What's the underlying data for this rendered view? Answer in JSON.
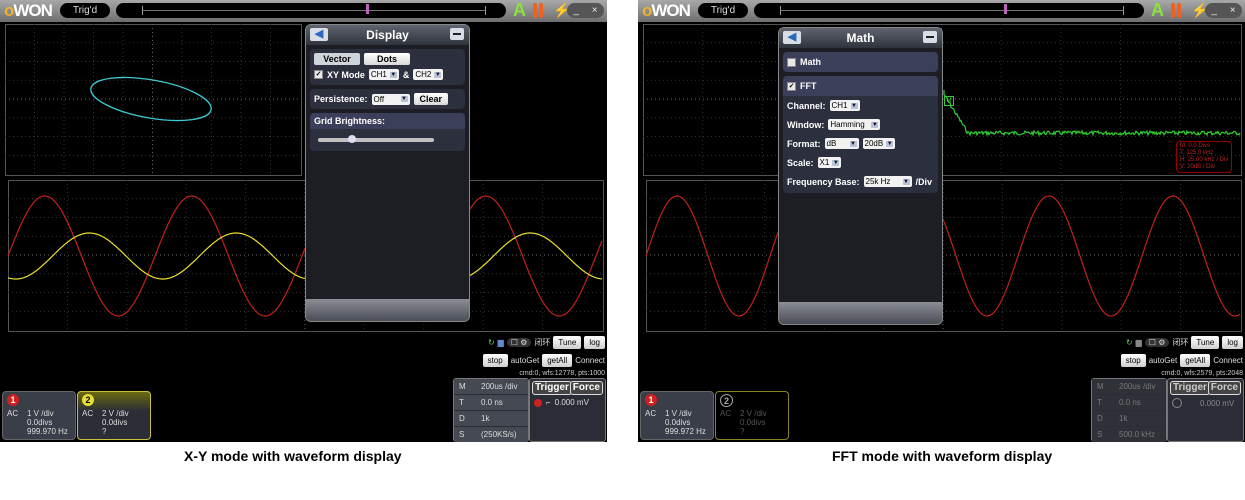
{
  "left": {
    "caption": "X-Y mode with waveform display",
    "topbar": {
      "logo_o": "o",
      "logo_rest": "WON",
      "trig_status": "Trig'd",
      "auto_icon": "A",
      "zoom_icon": "⚡",
      "min_label": "_",
      "close_label": "×"
    },
    "panel": {
      "title": "Display",
      "vector_label": "Vector",
      "dots_label": "Dots",
      "xy_mode_label": "XY Mode",
      "xy_checked": "✓",
      "xy_ch_a": "CH1",
      "amp": "&",
      "xy_ch_b": "CH2",
      "persistence_label": "Persistence:",
      "persistence_value": "Off",
      "clear_label": "Clear",
      "grid_brightness_label": "Grid Brightness:",
      "grid_brightness_value": 0.3
    },
    "tools": {
      "ring_label": "闭环",
      "tune": "Tune",
      "log": "log",
      "stop": "stop",
      "autoget": "autoGet",
      "getall": "getAll",
      "connect": "Connect",
      "cmd": "cmd:0, wfs:12778, pts:1000"
    },
    "ch1": {
      "num": "1",
      "coupling": "AC",
      "scale": "1 V /div",
      "offset": "0.0divs",
      "freq": "999.970 Hz"
    },
    "ch2": {
      "num": "2",
      "coupling": "AC",
      "scale": "2 V /div",
      "offset": "0.0divs",
      "freq": "?"
    },
    "timebase": {
      "rows": [
        {
          "k": "M",
          "v": "200us /div"
        },
        {
          "k": "T",
          "v": "0.0 ns"
        },
        {
          "k": "D",
          "v": "1k"
        },
        {
          "k": "S",
          "v": "(250KS/s)"
        }
      ]
    },
    "trigger": {
      "trigger_label": "Trigger",
      "force_label": "Force",
      "level": "0.000 mV"
    }
  },
  "right": {
    "caption": "FFT mode with waveform display",
    "topbar": {
      "logo_o": "o",
      "logo_rest": "WON",
      "trig_status": "Trig'd",
      "auto_icon": "A",
      "zoom_icon": "⚡",
      "min_label": "_",
      "close_label": "×"
    },
    "panel": {
      "title": "Math",
      "math_label": "Math",
      "fft_label": "FFT",
      "fft_checked": "✓",
      "channel_label": "Channel:",
      "channel_value": "CH1",
      "window_label": "Window:",
      "window_value": "Hamming",
      "format_label": "Format:",
      "format_value": "dB",
      "format_db_value": "20dB",
      "scale_label": "Scale:",
      "scale_value": "X1",
      "freq_base_label": "Frequency Base:",
      "freq_base_value": "25k Hz",
      "per_div": "/Div"
    },
    "fft_info": {
      "m": "M: 0.0 Divs",
      "t": "T: 125.0 kHz",
      "h": "H: 25.00 kHz / Div",
      "v": "V: 20dB / Div"
    },
    "fft_marker": "M",
    "tools": {
      "ring_label": "闭环",
      "tune": "Tune",
      "log": "log",
      "stop": "stop",
      "autoget": "autoGet",
      "getall": "getAll",
      "connect": "Connect",
      "cmd": "cmd:0, wfs:2579, pts:2048"
    },
    "ch1": {
      "num": "1",
      "coupling": "AC",
      "scale": "1 V /div",
      "offset": "0.0divs",
      "freq": "999.972 Hz"
    },
    "ch2": {
      "num": "2",
      "coupling": "AC",
      "scale": "2 V /div",
      "offset": "0.0divs",
      "freq": "?"
    },
    "timebase": {
      "rows": [
        {
          "k": "M",
          "v": "200us /div"
        },
        {
          "k": "T",
          "v": "0.0 ns"
        },
        {
          "k": "D",
          "v": "1k"
        },
        {
          "k": "S",
          "v": "500.0 kHz"
        }
      ]
    },
    "trigger": {
      "trigger_label": "Trigger",
      "force_label": "Force",
      "level": "0.000 mV"
    }
  },
  "colors": {
    "ch1": "#c0201c",
    "ch2": "#e8e030",
    "xy": "#40c8d0",
    "fft": "#30d030",
    "panel": "#1c1e23"
  }
}
